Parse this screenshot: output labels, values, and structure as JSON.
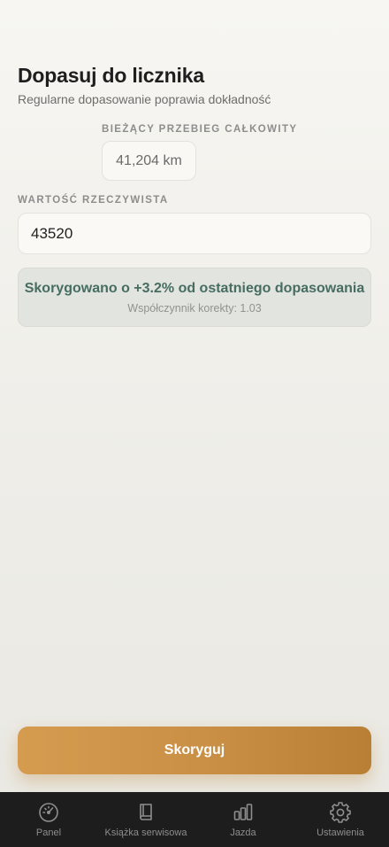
{
  "header": {
    "title": "Dopasuj do licznika",
    "subtitle": "Regularne dopasowanie poprawia dokładność"
  },
  "current": {
    "label": "BIEŻĄCY PRZEBIEG CAŁKOWITY",
    "value": "41,204 km"
  },
  "actual": {
    "label": "WARTOŚĆ RZECZYWISTA",
    "value": "43520"
  },
  "info": {
    "main": "Skorygowano o +3.2% od ostatniego dopasowania",
    "sub": "Współczynnik korekty: 1.03"
  },
  "actions": {
    "submit_label": "Skoryguj"
  },
  "tabs": [
    {
      "label": "Panel",
      "icon": "gauge-icon"
    },
    {
      "label": "Książka serwisowa",
      "icon": "book-icon"
    },
    {
      "label": "Jazda",
      "icon": "bar-chart-icon"
    },
    {
      "label": "Ustawienia",
      "icon": "gear-icon"
    }
  ],
  "colors": {
    "accent": "#c98f45",
    "success_text": "#476d63",
    "tabbar": "#1d1d1d"
  }
}
